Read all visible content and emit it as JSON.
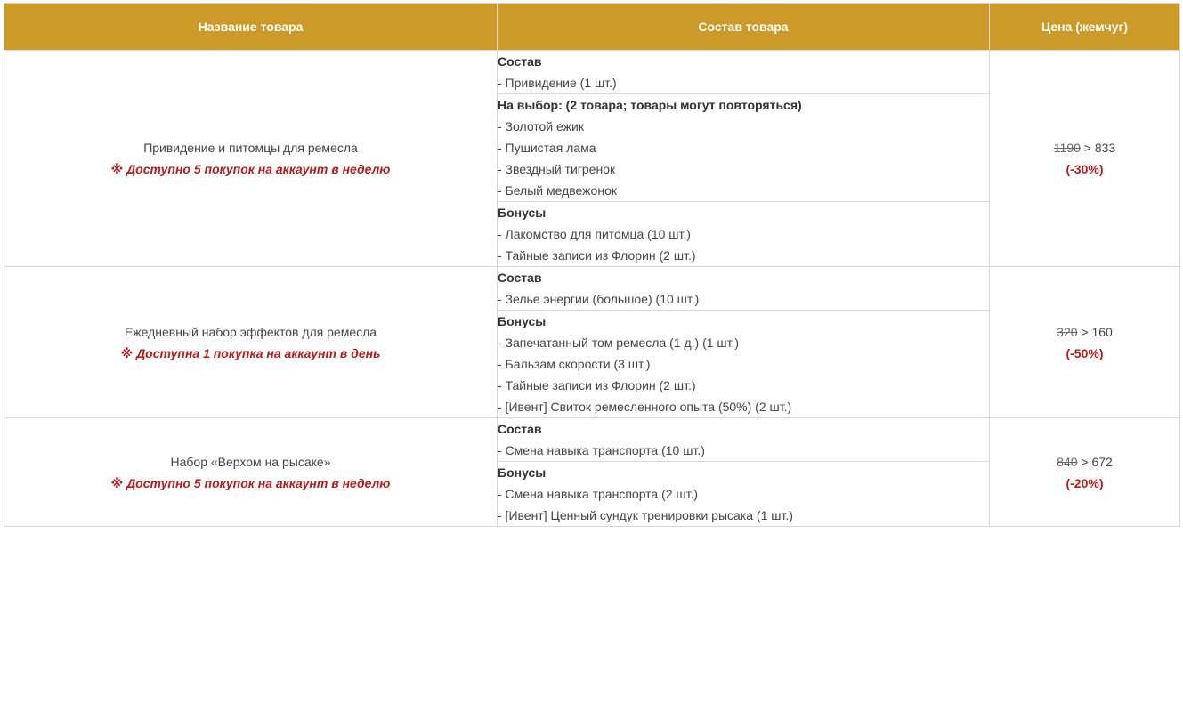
{
  "header": {
    "name": "Название товара",
    "composition": "Состав товара",
    "price": "Цена (жемчуг)"
  },
  "products": [
    {
      "name": "Привидение и питомцы для ремесла",
      "note": "※ Доступно 5 покупок на аккаунт в неделю",
      "old_price": "1190",
      "separator": " > ",
      "new_price": "833",
      "discount": "(-30%)",
      "sections": [
        {
          "title": "Состав",
          "items": [
            "- Привидение (1 шт.)"
          ]
        },
        {
          "title": "На выбор: (2 товара; товары могут повторяться)",
          "items": [
            "- Золотой ежик",
            "- Пушистая лама",
            "- Звездный тигренок",
            "- Белый медвежонок"
          ]
        },
        {
          "title": "Бонусы",
          "items": [
            "- Лакомство для питомца (10 шт.)",
            "- Тайные записи из Флорин (2 шт.)"
          ]
        }
      ]
    },
    {
      "name": "Ежедневный набор эффектов для ремесла",
      "note": "※ Доступна 1 покупка на аккаунт в день",
      "old_price": "320",
      "separator": " > ",
      "new_price": "160",
      "discount": "(-50%)",
      "sections": [
        {
          "title": "Состав",
          "items": [
            "- Зелье энергии (большое) (10 шт.)"
          ]
        },
        {
          "title": "Бонусы",
          "items": [
            "- Запечатанный том ремесла (1 д.) (1 шт.)",
            "- Бальзам скорости (3 шт.)",
            "- Тайные записи из Флорин (2 шт.)",
            "- [Ивент] Свиток ремесленного опыта (50%) (2 шт.)"
          ]
        }
      ]
    },
    {
      "name": "Набор «Верхом на рысаке»",
      "note": "※ Доступно 5 покупок на аккаунт в неделю",
      "old_price": "840",
      "separator": " > ",
      "new_price": "672",
      "discount": "(-20%)",
      "sections": [
        {
          "title": "Состав",
          "items": [
            "- Смена навыка транспорта (10 шт.)"
          ]
        },
        {
          "title": "Бонусы",
          "items": [
            "- Смена навыка транспорта (2 шт.)",
            "- [Ивент] Ценный сундук тренировки рысака (1 шт.)"
          ]
        }
      ]
    }
  ]
}
